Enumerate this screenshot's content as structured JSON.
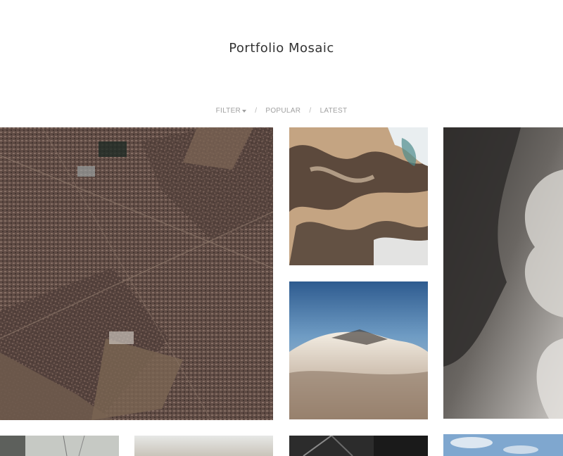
{
  "header": {
    "title": "Portfolio Mosaic"
  },
  "filters": {
    "filter_label": "FILTER",
    "separator": "/",
    "popular_label": "POPULAR",
    "latest_label": "LATEST"
  },
  "gallery": {
    "tiles": [
      {
        "id": "aerial-city",
        "subject": "aerial view of suburban city grid"
      },
      {
        "id": "aerial-terrain",
        "subject": "aerial view of brown terrain and snow"
      },
      {
        "id": "storm-clouds",
        "subject": "dark storm clouds"
      },
      {
        "id": "mountain-clouds",
        "subject": "mountain peak above clouds"
      },
      {
        "id": "power-lines",
        "subject": "power line tower"
      },
      {
        "id": "hazy-horizon",
        "subject": "hazy horizon"
      },
      {
        "id": "dark-structure",
        "subject": "dark steel structure"
      },
      {
        "id": "blue-sky",
        "subject": "blue sky with clouds"
      }
    ]
  },
  "colors": {
    "title": "#333333",
    "filter_text": "#a0a0a0",
    "background": "#ffffff"
  }
}
